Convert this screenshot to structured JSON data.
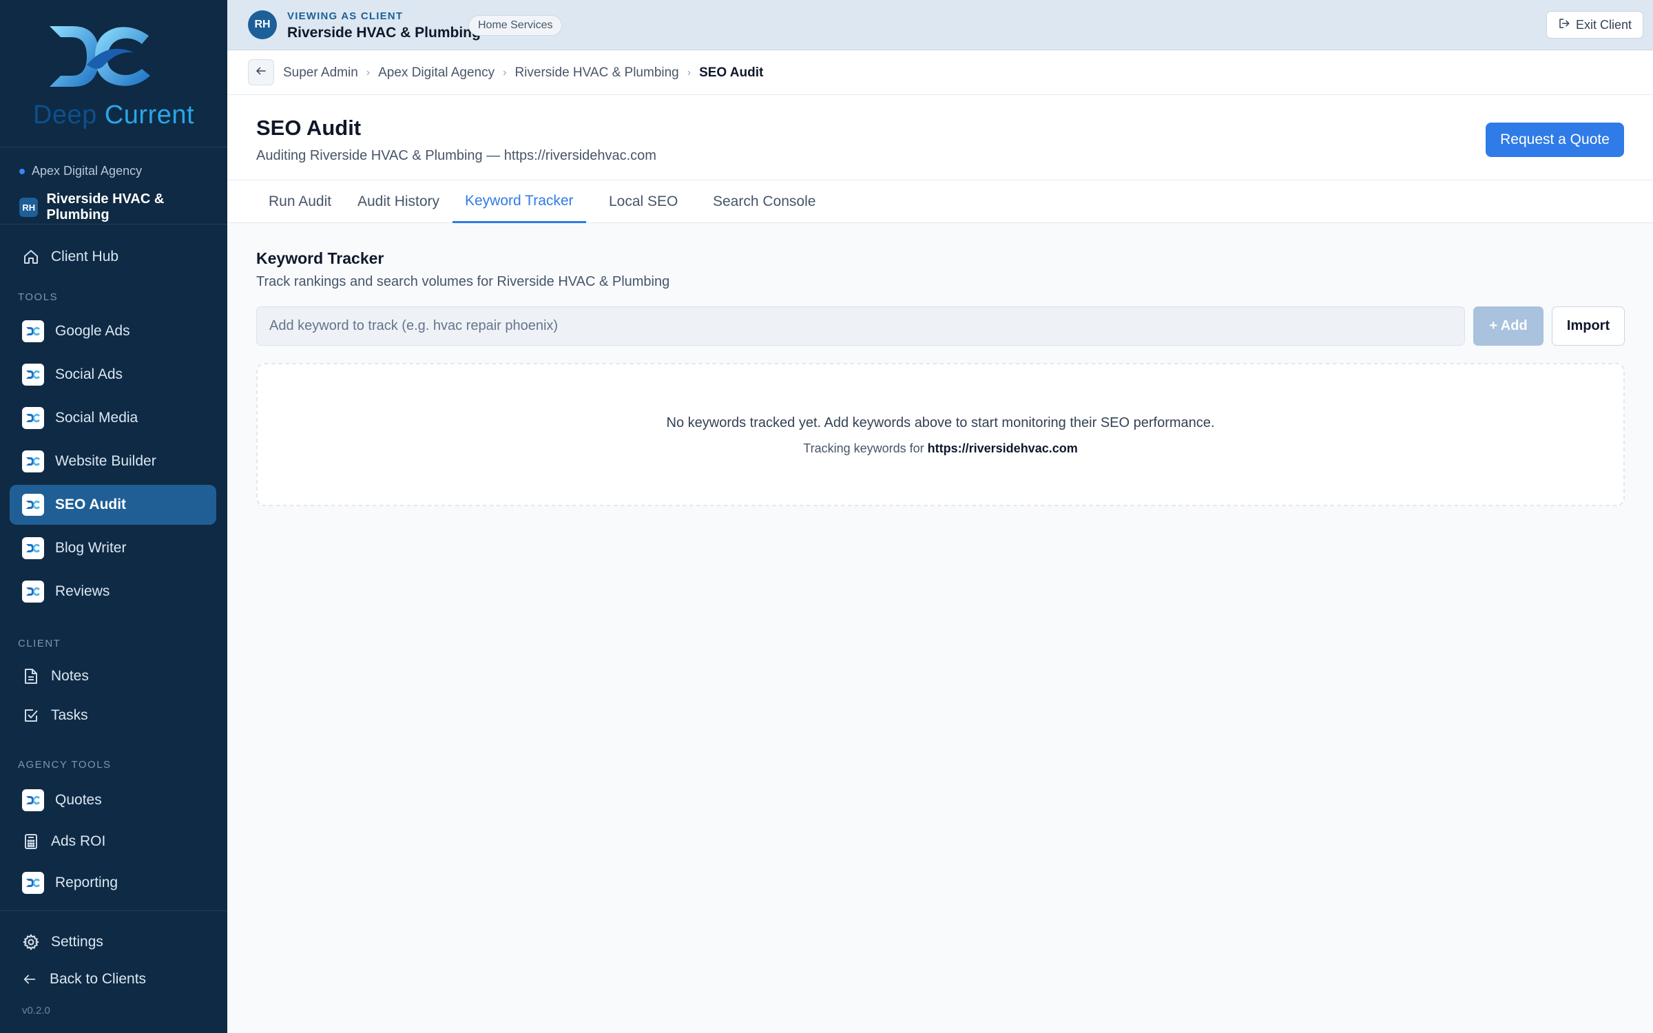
{
  "app": {
    "logo_word_1": "Deep",
    "logo_word_2": "Current",
    "version": "v0.2.0"
  },
  "colors": {
    "sidebar_bg": "#0f2a44",
    "active_nav": "#1f5f95",
    "accent_blue": "#2f7be8",
    "banner_bg": "#dde7f1"
  },
  "sidebar": {
    "agency": "Apex Digital Agency",
    "client_initials": "RH",
    "client_name": "Riverside HVAC & Plumbing",
    "client_hub": {
      "label": "Client Hub",
      "icon": "home-icon"
    },
    "tools_label": "TOOLS",
    "tools": [
      {
        "label": "Google Ads",
        "icon": "app-logo-icon"
      },
      {
        "label": "Social Ads",
        "icon": "app-logo-icon"
      },
      {
        "label": "Social Media",
        "icon": "app-logo-icon"
      },
      {
        "label": "Website Builder",
        "icon": "app-logo-icon"
      },
      {
        "label": "SEO Audit",
        "icon": "app-logo-icon",
        "active": true
      },
      {
        "label": "Blog Writer",
        "icon": "app-logo-icon"
      },
      {
        "label": "Reviews",
        "icon": "app-logo-icon"
      }
    ],
    "client_label": "CLIENT",
    "client_items": [
      {
        "label": "Notes",
        "icon": "document-icon"
      },
      {
        "label": "Tasks",
        "icon": "checkbox-icon"
      }
    ],
    "agency_tools_label": "AGENCY TOOLS",
    "agency_items": [
      {
        "label": "Quotes",
        "icon": "app-logo-icon"
      },
      {
        "label": "Ads ROI",
        "icon": "calculator-icon"
      },
      {
        "label": "Reporting",
        "icon": "app-logo-icon"
      }
    ],
    "settings": {
      "label": "Settings",
      "icon": "gear-icon"
    },
    "back_to_clients": {
      "label": "Back to Clients",
      "icon": "arrow-left-icon"
    }
  },
  "banner": {
    "initials": "RH",
    "viewing_label": "VIEWING AS CLIENT",
    "client_name": "Riverside HVAC & Plumbing",
    "industry": "Home Services",
    "exit_label": "Exit Client"
  },
  "breadcrumb": {
    "items": [
      "Super Admin",
      "Apex Digital Agency",
      "Riverside HVAC & Plumbing"
    ],
    "current": "SEO Audit"
  },
  "page": {
    "title": "SEO Audit",
    "subtitle": "Auditing Riverside HVAC & Plumbing — https://riversidehvac.com",
    "quote_button": "Request a Quote"
  },
  "tabs": [
    {
      "label": "Run Audit"
    },
    {
      "label": "Audit History"
    },
    {
      "label": "Keyword Tracker",
      "active": true
    },
    {
      "label": "Local SEO"
    },
    {
      "label": "Search Console"
    }
  ],
  "keyword_tracker": {
    "title": "Keyword Tracker",
    "subtitle": "Track rankings and search volumes for Riverside HVAC & Plumbing",
    "input_placeholder": "Add keyword to track (e.g. hvac repair phoenix)",
    "input_value": "",
    "add_button": "+ Add",
    "import_button": "Import",
    "empty_message": "No keywords tracked yet. Add keywords above to start monitoring their SEO performance.",
    "tracking_prefix": "Tracking keywords for",
    "tracking_url": "https://riversidehvac.com"
  }
}
